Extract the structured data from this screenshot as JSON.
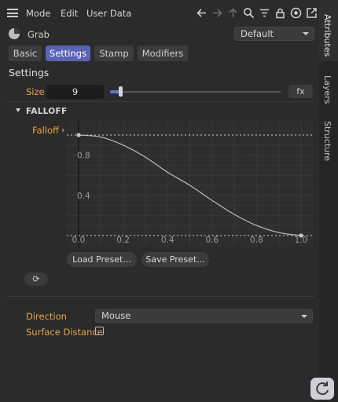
{
  "menubar": {
    "items": [
      "Mode",
      "Edit",
      "User Data"
    ]
  },
  "toolbar_icons": [
    "arrow-left-icon",
    "arrow-right-icon",
    "arrow-up-icon",
    "search-icon",
    "filter-icon",
    "lock-icon",
    "target-icon",
    "new-window-icon"
  ],
  "object": {
    "name": "Grab",
    "preset": "Default"
  },
  "tabs": [
    {
      "label": "Basic",
      "active": false
    },
    {
      "label": "Settings",
      "active": true
    },
    {
      "label": "Stamp",
      "active": false
    },
    {
      "label": "Modifiers",
      "active": false
    }
  ],
  "settings": {
    "title": "Settings",
    "size_label": "Size",
    "size_value": "9",
    "size_slider_fraction": 0.06,
    "fx_label": "fx"
  },
  "falloff": {
    "group_title": "FALLOFF",
    "label": "Falloff",
    "load_preset": "Load Preset...",
    "save_preset": "Save Preset..."
  },
  "chart_data": {
    "type": "line",
    "x_ticks": [
      "0.0",
      "0.2",
      "0.4",
      "0.6",
      "0.8",
      "1.0"
    ],
    "y_ticks": [
      "0.8",
      "0.4"
    ],
    "xlim": [
      0,
      1
    ],
    "ylim": [
      0,
      1
    ],
    "series": [
      {
        "x": [
          0,
          0.1,
          0.2,
          0.3,
          0.4,
          0.5,
          0.6,
          0.7,
          0.8,
          0.9,
          1.0
        ],
        "y": [
          1.0,
          0.98,
          0.9,
          0.78,
          0.63,
          0.5,
          0.35,
          0.21,
          0.1,
          0.03,
          0.0
        ]
      }
    ],
    "grid": true
  },
  "direction": {
    "label": "Direction",
    "value": "Mouse"
  },
  "surface_distance": {
    "label": "Surface Distance",
    "checked": false
  },
  "side_tabs": [
    {
      "label": "Attributes",
      "active": true
    },
    {
      "label": "Layers",
      "active": false
    },
    {
      "label": "Structure",
      "active": false
    }
  ]
}
